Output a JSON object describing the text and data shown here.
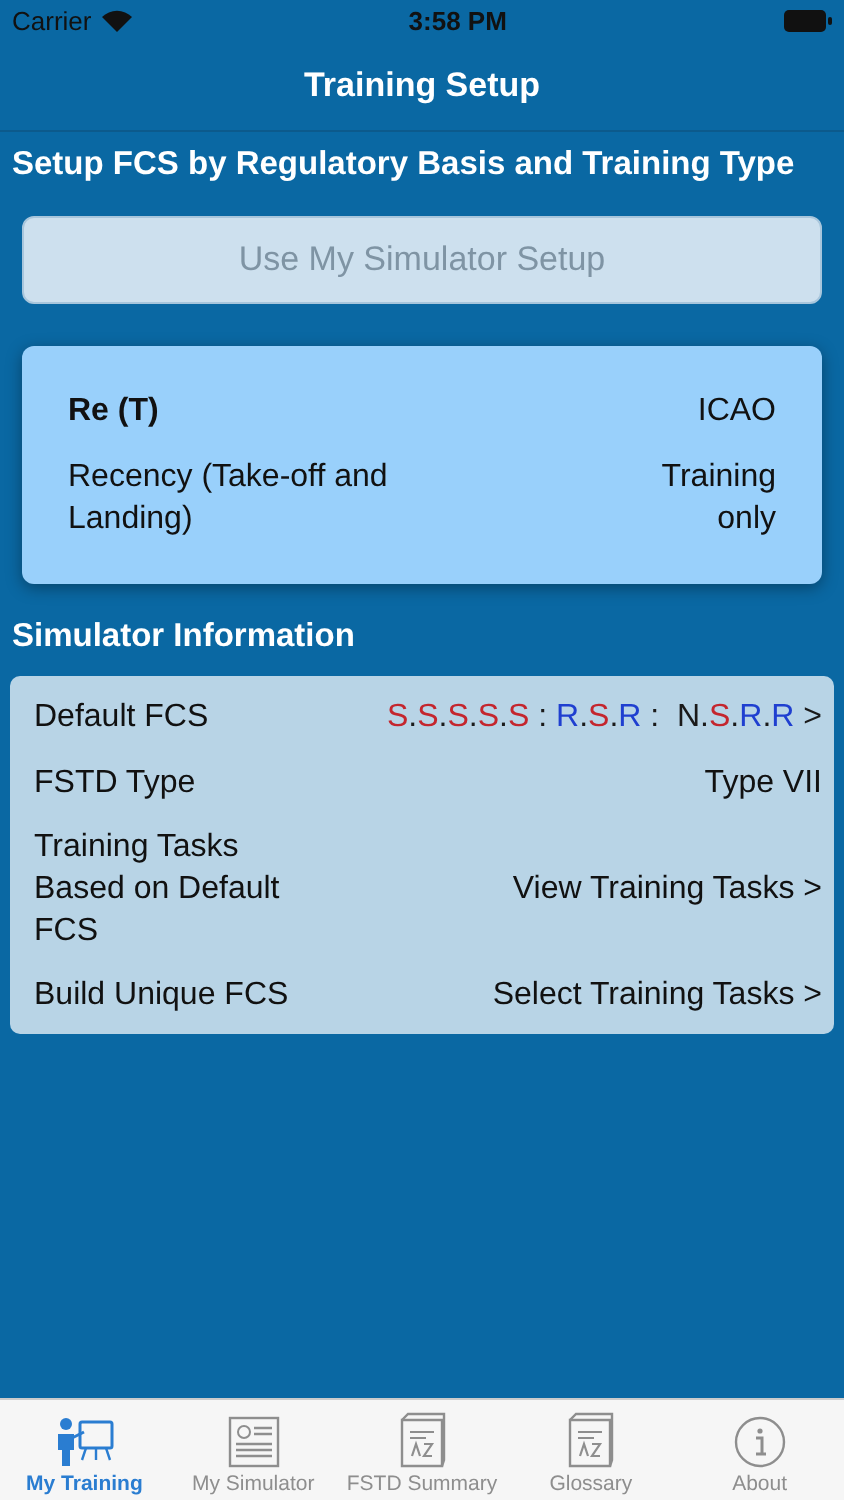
{
  "status_bar": {
    "carrier": "Carrier",
    "time": "3:58 PM"
  },
  "nav_bar": {
    "title": "Training Setup"
  },
  "heading": "Setup FCS by Regulatory Basis and Training Type",
  "setup_button": {
    "label": "Use My Simulator Setup",
    "disabled": true
  },
  "summary_card": {
    "rows": [
      {
        "label": "Re (T)",
        "value": "ICAO",
        "bold": true
      },
      {
        "label": "Recency (Take-off and Landing)",
        "value": "Training only",
        "bold": false
      }
    ]
  },
  "simulator_section": {
    "title": "Simulator Information",
    "rows": [
      {
        "kind": "code",
        "label": "Default FCS",
        "segments": [
          {
            "text": "S",
            "color": "#c4262e"
          },
          {
            "text": ".",
            "color": "#1a1a1a"
          },
          {
            "text": "S",
            "color": "#c4262e"
          },
          {
            "text": ".",
            "color": "#1a1a1a"
          },
          {
            "text": "S",
            "color": "#c4262e"
          },
          {
            "text": ".",
            "color": "#1a1a1a"
          },
          {
            "text": "S",
            "color": "#c4262e"
          },
          {
            "text": ".",
            "color": "#1a1a1a"
          },
          {
            "text": "S",
            "color": "#c4262e"
          },
          {
            "text": " : ",
            "color": "#1a1a1a"
          },
          {
            "text": "R",
            "color": "#1f3fd0"
          },
          {
            "text": ".",
            "color": "#1a1a1a"
          },
          {
            "text": "S",
            "color": "#c4262e"
          },
          {
            "text": ".",
            "color": "#1a1a1a"
          },
          {
            "text": "R",
            "color": "#1f3fd0"
          },
          {
            "text": " :  ",
            "color": "#1a1a1a"
          },
          {
            "text": "N",
            "color": "#1a1a1a"
          },
          {
            "text": ".",
            "color": "#1a1a1a"
          },
          {
            "text": "S",
            "color": "#c4262e"
          },
          {
            "text": ".",
            "color": "#1a1a1a"
          },
          {
            "text": "R",
            "color": "#1f3fd0"
          },
          {
            "text": ".",
            "color": "#1a1a1a"
          },
          {
            "text": "R",
            "color": "#1f3fd0"
          },
          {
            "text": " >",
            "color": "#1a1a1a"
          }
        ]
      },
      {
        "kind": "text",
        "label": "FSTD Type",
        "value": "Type VII"
      },
      {
        "kind": "link",
        "label": "Training Tasks Based on Default FCS",
        "value": "View Training Tasks >"
      },
      {
        "kind": "link",
        "label": "Build Unique FCS",
        "value": "Select Training Tasks >"
      }
    ]
  },
  "tab_bar": [
    {
      "label": "My Training",
      "kind": "trainer",
      "selected": true
    },
    {
      "label": "My Simulator",
      "kind": "document",
      "selected": false
    },
    {
      "label": "FSTD Summary",
      "kind": "book",
      "selected": false
    },
    {
      "label": "Glossary",
      "kind": "book",
      "selected": false
    },
    {
      "label": "About",
      "kind": "info",
      "selected": false
    }
  ]
}
